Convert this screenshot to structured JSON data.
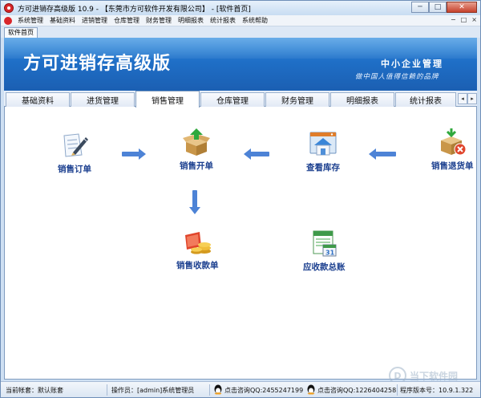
{
  "window": {
    "title": "方可进销存高级版 10.9 - 【东莞市方可软件开发有限公司】 - [软件首页]",
    "buttons": {
      "minimize": "─",
      "maximize": "□",
      "close": "✕"
    }
  },
  "menubar": {
    "items": [
      "系统管理",
      "基础资料",
      "进销管理",
      "仓库管理",
      "财务管理",
      "明细报表",
      "统计报表",
      "系统帮助"
    ],
    "right_controls": [
      "−",
      "□",
      "×"
    ]
  },
  "doc_tabs": [
    {
      "label": "软件首页"
    }
  ],
  "banner": {
    "title": "方可进销存高级版",
    "tagline": "中小企业管理",
    "slogan": "做中国人值得信赖的品牌"
  },
  "module_tabs": {
    "items": [
      "基础资料",
      "进货管理",
      "销售管理",
      "仓库管理",
      "财务管理",
      "明细报表",
      "统计报表"
    ],
    "active": "销售管理",
    "nav": [
      "◂",
      "▸"
    ]
  },
  "functions": {
    "sales_order": "销售订单",
    "sales_issue": "销售开单",
    "view_stock": "查看库存",
    "sales_return": "销售退货单",
    "sales_receipt": "销售收款单",
    "receivable_summary": "应收款总账"
  },
  "status": {
    "account": "当前帐套：默认账套",
    "operator": "操作员：[admin]系统管理员",
    "qq1": "点击咨询QQ:2455247199",
    "qq2": "点击咨询QQ:1226404258",
    "version": "程序版本号：10.9.1.322"
  },
  "watermark": {
    "text": "当下软件园",
    "mark": "D"
  },
  "colors": {
    "banner": "#1f6fc7",
    "label": "#1b3f8f",
    "arrow": "#4d83d6",
    "frame": "#cfe0f3"
  },
  "icons": {
    "sales_order": "pen-paper-icon",
    "sales_issue": "box-up-arrow-icon",
    "view_stock": "warehouse-house-icon",
    "sales_return": "box-cancel-icon",
    "sales_receipt": "money-coins-icon",
    "receivable_summary": "calendar-ledger-icon",
    "qq": "qq-penguin-icon"
  }
}
